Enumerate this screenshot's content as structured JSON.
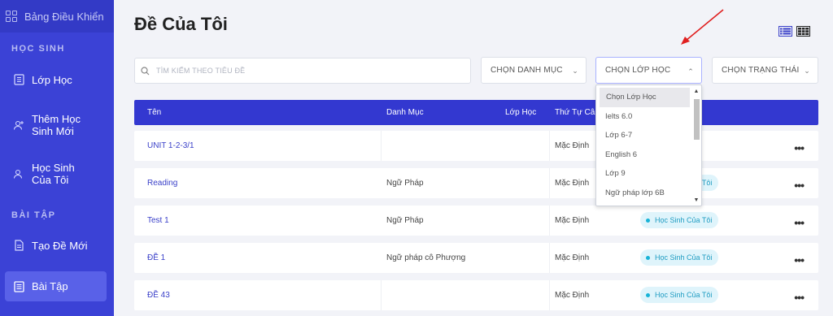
{
  "sidebar": {
    "dashboard_label": "Bảng Điều Khiển",
    "section_students": "HỌC SINH",
    "section_exercises": "BÀI TẬP",
    "items": [
      {
        "label": "Lớp Học"
      },
      {
        "label": "Thêm Học Sinh Mới"
      },
      {
        "label": "Học Sinh Của Tôi"
      },
      {
        "label": "Tạo Đề Mới"
      },
      {
        "label": "Bài Tập"
      }
    ]
  },
  "page": {
    "title": "Đề Của Tôi"
  },
  "filters": {
    "search_placeholder": "TÌM KIẾM THEO TIÊU ĐỀ",
    "category": "CHỌN DANH MỤC",
    "class": "CHỌN LỚP HỌC",
    "status": "CHỌN TRẠNG THÁI"
  },
  "class_dropdown": {
    "options": [
      "Chọn Lớp Học",
      "Ielts 6.0",
      "Lớp 6-7",
      "English 6",
      "Lớp 9",
      "Ngữ pháp lớp 6B"
    ]
  },
  "table": {
    "headers": {
      "name": "Tên",
      "category": "Danh Mục",
      "class": "Lớp Học",
      "order": "Thứ Tự Câu"
    },
    "rows": [
      {
        "name": "UNIT 1-2-3/1",
        "category": "",
        "order": "Mặc Định",
        "status": ""
      },
      {
        "name": "Reading",
        "category": "Ngữ Pháp",
        "order": "Mặc Định",
        "status": "Học Sinh Của Tôi"
      },
      {
        "name": "Test 1",
        "category": "Ngữ Pháp",
        "order": "Mặc Định",
        "status": "Học Sinh Của Tôi"
      },
      {
        "name": "ĐỀ 1",
        "category": "Ngữ pháp cô Phượng",
        "order": "Mặc Định",
        "status": "Học Sinh Của Tôi"
      },
      {
        "name": "ĐỀ 43",
        "category": "",
        "order": "Mặc Định",
        "status": "Học Sinh Của Tôi"
      }
    ],
    "more_label": "•••"
  },
  "colors": {
    "sidebar": "#3b42d6",
    "header": "#3338d0",
    "accent": "#3a40c9",
    "annotation_arrow": "#e02020"
  }
}
